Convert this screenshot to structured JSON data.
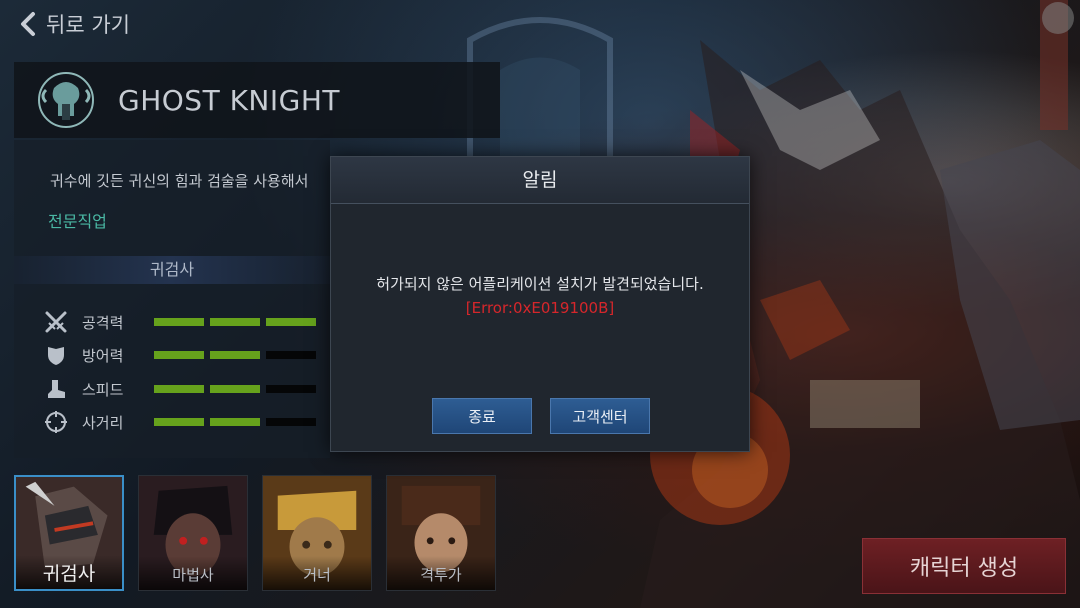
{
  "nav": {
    "back_label": "뒤로 가기"
  },
  "character_class": {
    "name": "GHOST KNIGHT",
    "description": "귀수에 깃든 귀신의 힘과 검술을 사용해서",
    "specialization_label": "전문직업",
    "subclass_name": "귀검사"
  },
  "stats": [
    {
      "icon": "swords-icon",
      "label": "공격력",
      "filled": 3,
      "total": 3
    },
    {
      "icon": "shield-icon",
      "label": "방어력",
      "filled": 2,
      "total": 3
    },
    {
      "icon": "boot-icon",
      "label": "스피드",
      "filled": 2,
      "total": 3
    },
    {
      "icon": "crosshair-icon",
      "label": "사거리",
      "filled": 2,
      "total": 3
    }
  ],
  "characters": [
    {
      "name": "귀검사",
      "selected": true
    },
    {
      "name": "마법사",
      "selected": false
    },
    {
      "name": "거너",
      "selected": false
    },
    {
      "name": "격투가",
      "selected": false
    }
  ],
  "create_button_label": "캐릭터 생성",
  "dialog": {
    "title": "알림",
    "message": "허가되지 않은 어플리케이션 설치가 발견되었습니다.",
    "error_code": "[Error:0xE019100B]",
    "buttons": {
      "exit": "종료",
      "support": "고객센터"
    }
  },
  "colors": {
    "stat_bar_filled": "#66a21c",
    "error_text": "#d6262b",
    "specialization_text": "#4ab8a4",
    "dialog_button": "#2e5d93",
    "create_button": "#6e2024",
    "selected_border": "#3a8fc8"
  }
}
